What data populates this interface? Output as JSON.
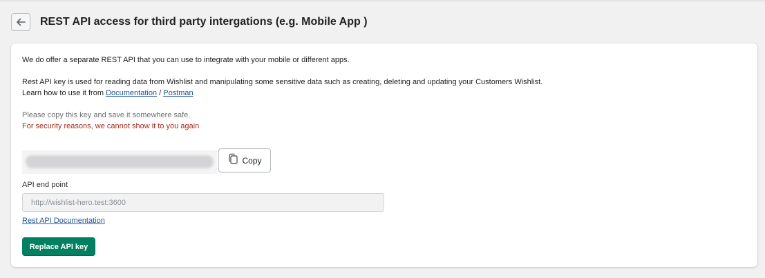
{
  "header": {
    "title": "REST API access for third party intergations (e.g. Mobile App )"
  },
  "card": {
    "intro": "We do offer a separate REST API that you can use to integrate with your mobile or different apps.",
    "description": "Rest API key is used for reading data from Wishlist and manipulating some sensitive data such as creating, deleting and updating your Customers Wishlist.",
    "learn_prefix": "Learn how to use it from ",
    "documentation_link": "Documentation",
    "separator": " / ",
    "postman_link": "Postman",
    "copy_note": "Please copy this key and save it somewhere safe.",
    "security_warning": "For security reasons, we cannot show it to you again",
    "copy_button": "Copy",
    "endpoint_label": "API end point",
    "endpoint_placeholder": "http://wishlist-hero.test:3600",
    "rest_docs_link": "Rest API Documentation",
    "replace_button": "Replace API key"
  },
  "colors": {
    "primary": "#008060",
    "link": "#1f5199",
    "critical": "#a42b18",
    "background": "#f1f1f2"
  },
  "icons": {
    "back": "arrow-left-icon",
    "copy": "copy-icon"
  }
}
